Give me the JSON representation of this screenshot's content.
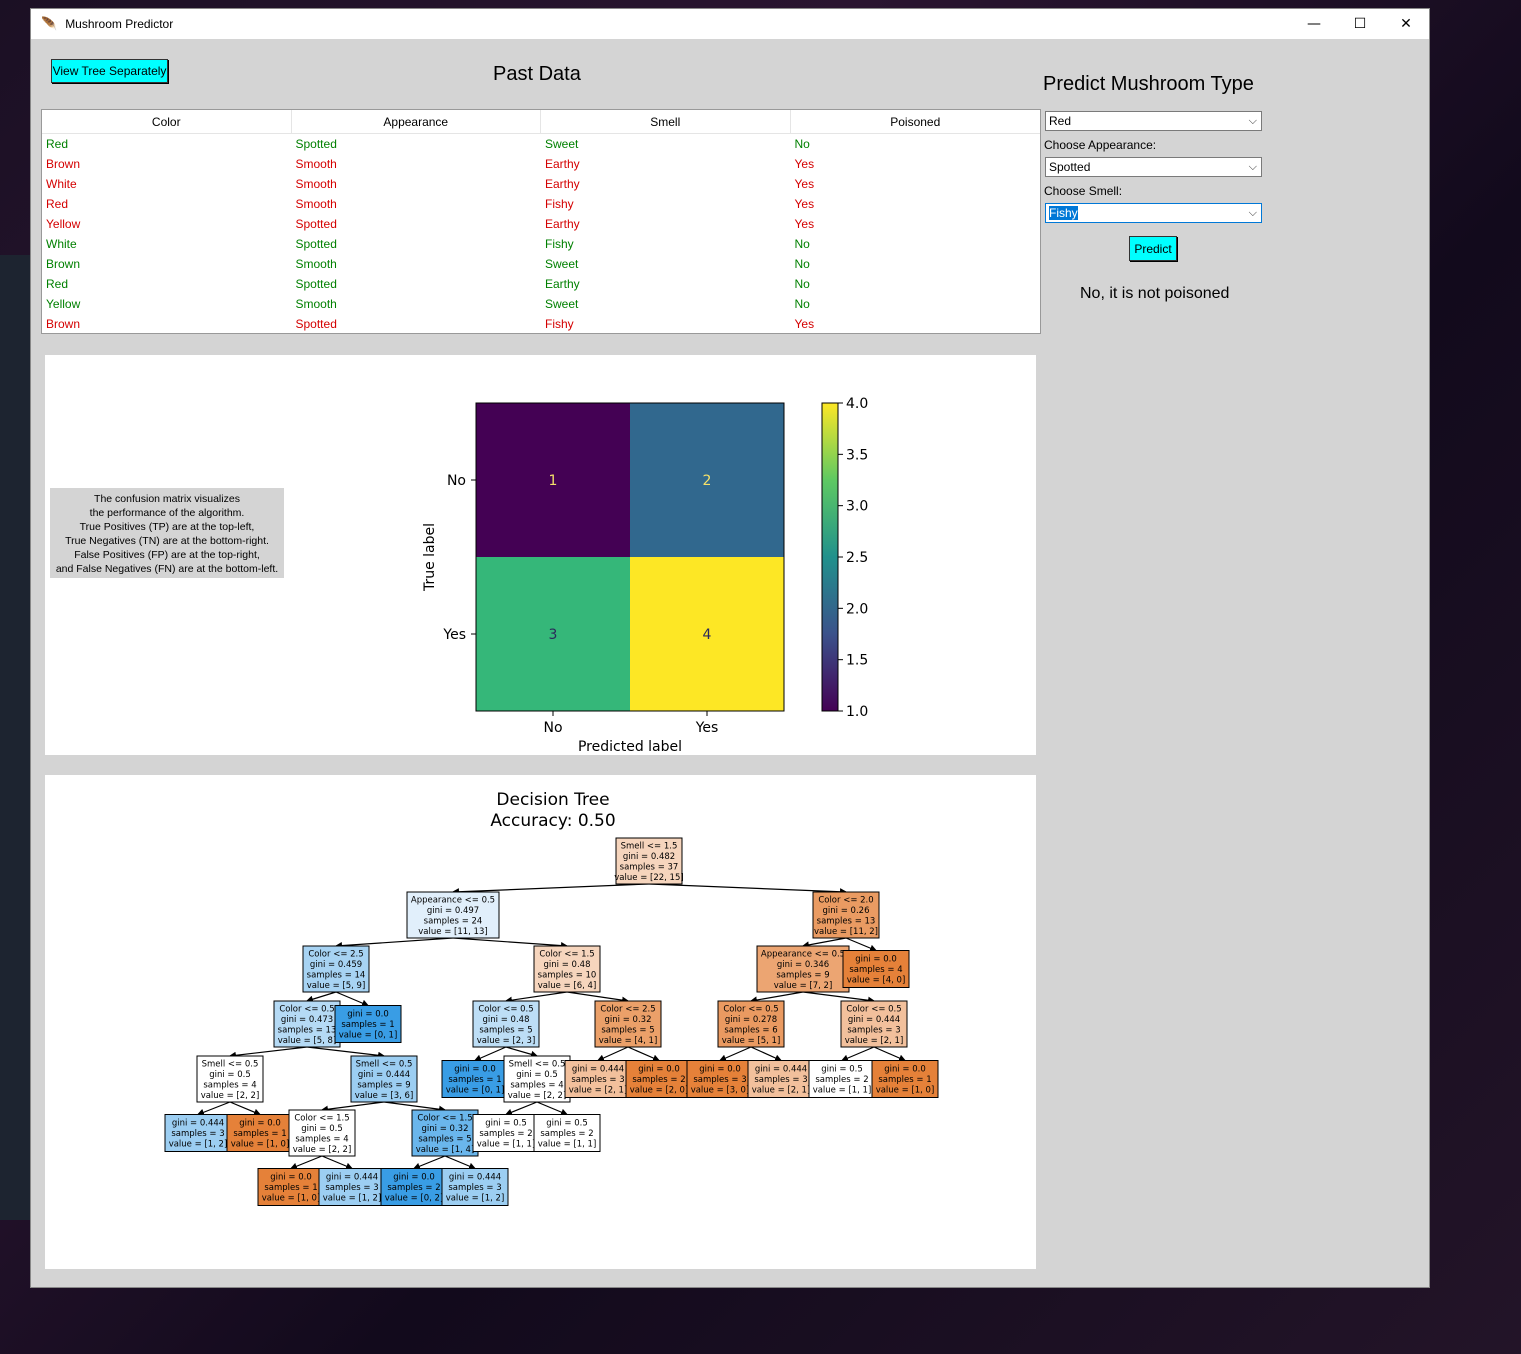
{
  "window": {
    "title": "Mushroom Predictor"
  },
  "toolbar": {
    "view_tree_label": "View Tree Separately"
  },
  "past_data": {
    "title": "Past Data",
    "columns": [
      "Color",
      "Appearance",
      "Smell",
      "Poisoned"
    ],
    "rows": [
      {
        "color": "Red",
        "appearance": "Spotted",
        "smell": "Sweet",
        "poisoned": "No",
        "status": "green"
      },
      {
        "color": "Brown",
        "appearance": "Smooth",
        "smell": "Earthy",
        "poisoned": "Yes",
        "status": "red"
      },
      {
        "color": "White",
        "appearance": "Smooth",
        "smell": "Earthy",
        "poisoned": "Yes",
        "status": "red"
      },
      {
        "color": "Red",
        "appearance": "Smooth",
        "smell": "Fishy",
        "poisoned": "Yes",
        "status": "red"
      },
      {
        "color": "Yellow",
        "appearance": "Spotted",
        "smell": "Earthy",
        "poisoned": "Yes",
        "status": "red"
      },
      {
        "color": "White",
        "appearance": "Spotted",
        "smell": "Fishy",
        "poisoned": "No",
        "status": "green"
      },
      {
        "color": "Brown",
        "appearance": "Smooth",
        "smell": "Sweet",
        "poisoned": "No",
        "status": "green"
      },
      {
        "color": "Red",
        "appearance": "Spotted",
        "smell": "Earthy",
        "poisoned": "No",
        "status": "green"
      },
      {
        "color": "Yellow",
        "appearance": "Smooth",
        "smell": "Sweet",
        "poisoned": "No",
        "status": "green"
      },
      {
        "color": "Brown",
        "appearance": "Spotted",
        "smell": "Fishy",
        "poisoned": "Yes",
        "status": "red"
      }
    ]
  },
  "predict": {
    "title": "Predict Mushroom Type",
    "color_value": "Red",
    "appearance_label": "Choose Appearance:",
    "appearance_value": "Spotted",
    "smell_label": "Choose Smell:",
    "smell_value": "Fishy",
    "button_label": "Predict",
    "result": "No, it is not poisoned"
  },
  "confusion_text": "The confusion matrix visualizes\nthe performance of the algorithm.\nTrue Positives (TP) are at the top-left,\nTrue Negatives (TN) are at the bottom-right.\nFalse Positives (FP) are at the top-right,\nand False Negatives (FN) are at the bottom-left.",
  "chart_data": [
    {
      "type": "heatmap",
      "rows": [
        "No",
        "Yes"
      ],
      "columns": [
        "No",
        "Yes"
      ],
      "values": [
        [
          1,
          2
        ],
        [
          3,
          4
        ]
      ],
      "xlabel": "Predicted label",
      "ylabel": "True label",
      "colorbar": {
        "min": 1.0,
        "max": 4.0,
        "ticks": [
          "1.0",
          "1.5",
          "2.0",
          "2.5",
          "3.0",
          "3.5",
          "4.0"
        ]
      },
      "colors": {
        "1": "#440154",
        "2": "#31688e",
        "3": "#35b779",
        "4": "#fde725"
      }
    }
  ],
  "decision_tree": {
    "title": "Decision Tree",
    "subtitle": "Accuracy: 0.50",
    "nodes": [
      {
        "id": "n0",
        "lines": [
          "Smell <= 1.5",
          "gini = 0.482",
          "samples = 37",
          "value = [22, 15]"
        ],
        "fill": "#f6d5bd"
      },
      {
        "id": "n1",
        "lines": [
          "Appearance <= 0.5",
          "gini = 0.497",
          "samples = 24",
          "value = [11, 13]"
        ],
        "fill": "#e1effb"
      },
      {
        "id": "n2",
        "lines": [
          "Color <= 2.0",
          "gini = 0.26",
          "samples = 13",
          "value = [11, 2]"
        ],
        "fill": "#ea9b62"
      },
      {
        "id": "n3",
        "lines": [
          "Color <= 2.5",
          "gini = 0.459",
          "samples = 14",
          "value = [5, 9]"
        ],
        "fill": "#a7d3f3"
      },
      {
        "id": "n4",
        "lines": [
          "Color <= 1.5",
          "gini = 0.48",
          "samples = 10",
          "value = [6, 4]"
        ],
        "fill": "#f6d5bd"
      },
      {
        "id": "n5",
        "lines": [
          "Appearance <= 0.5",
          "gini = 0.346",
          "samples = 9",
          "value = [7, 2]"
        ],
        "fill": "#eca572"
      },
      {
        "id": "n6",
        "lines": [
          "gini = 0.0",
          "samples = 4",
          "value = [4, 0]"
        ],
        "fill": "#e58139"
      },
      {
        "id": "n7",
        "lines": [
          "Color <= 0.5",
          "gini = 0.473",
          "samples = 13",
          "value = [5, 8]"
        ],
        "fill": "#b5daf5"
      },
      {
        "id": "n8",
        "lines": [
          "gini = 0.0",
          "samples = 1",
          "value = [0, 1]"
        ],
        "fill": "#399de5"
      },
      {
        "id": "n9",
        "lines": [
          "Color <= 0.5",
          "gini = 0.48",
          "samples = 5",
          "value = [2, 3]"
        ],
        "fill": "#bddef6"
      },
      {
        "id": "n10",
        "lines": [
          "Color <= 2.5",
          "gini = 0.32",
          "samples = 5",
          "value = [4, 1]"
        ],
        "fill": "#eba069"
      },
      {
        "id": "n11",
        "lines": [
          "Color <= 0.5",
          "gini = 0.278",
          "samples = 6",
          "value = [5, 1]"
        ],
        "fill": "#ea9a61"
      },
      {
        "id": "n12",
        "lines": [
          "Color <= 0.5",
          "gini = 0.444",
          "samples = 3",
          "value = [2, 1]"
        ],
        "fill": "#f2c09c"
      },
      {
        "id": "n13",
        "lines": [
          "Smell <= 0.5",
          "gini = 0.5",
          "samples = 4",
          "value = [2, 2]"
        ],
        "fill": "#ffffff"
      },
      {
        "id": "n14",
        "lines": [
          "Smell <= 0.5",
          "gini = 0.444",
          "samples = 9",
          "value = [3, 6]"
        ],
        "fill": "#9ccef2"
      },
      {
        "id": "n15",
        "lines": [
          "gini = 0.0",
          "samples = 1",
          "value = [0, 1]"
        ],
        "fill": "#399de5"
      },
      {
        "id": "n16",
        "lines": [
          "Smell <= 0.5",
          "gini = 0.5",
          "samples = 4",
          "value = [2, 2]"
        ],
        "fill": "#ffffff"
      },
      {
        "id": "n17",
        "lines": [
          "gini = 0.444",
          "samples = 3",
          "value = [2, 1]"
        ],
        "fill": "#f2c09c"
      },
      {
        "id": "n18",
        "lines": [
          "gini = 0.0",
          "samples = 2",
          "value = [2, 0]"
        ],
        "fill": "#e58139"
      },
      {
        "id": "n19",
        "lines": [
          "gini = 0.0",
          "samples = 3",
          "value = [3, 0]"
        ],
        "fill": "#e58139"
      },
      {
        "id": "n20",
        "lines": [
          "gini = 0.444",
          "samples = 3",
          "value = [2, 1]"
        ],
        "fill": "#f2c09c"
      },
      {
        "id": "n21",
        "lines": [
          "gini = 0.5",
          "samples = 2",
          "value = [1, 1]"
        ],
        "fill": "#ffffff"
      },
      {
        "id": "n22",
        "lines": [
          "gini = 0.0",
          "samples = 1",
          "value = [1, 0]"
        ],
        "fill": "#e58139"
      },
      {
        "id": "n23",
        "lines": [
          "gini = 0.444",
          "samples = 3",
          "value = [1, 2]"
        ],
        "fill": "#9ccef2"
      },
      {
        "id": "n24",
        "lines": [
          "gini = 0.0",
          "samples = 1",
          "value = [1, 0]"
        ],
        "fill": "#e58139"
      },
      {
        "id": "n25",
        "lines": [
          "Color <= 1.5",
          "gini = 0.5",
          "samples = 4",
          "value = [2, 2]"
        ],
        "fill": "#ffffff"
      },
      {
        "id": "n26",
        "lines": [
          "Color <= 1.5",
          "gini = 0.32",
          "samples = 5",
          "value = [1, 4]"
        ],
        "fill": "#6ab6ec"
      },
      {
        "id": "n27",
        "lines": [
          "gini = 0.5",
          "samples = 2",
          "value = [1, 1]"
        ],
        "fill": "#ffffff"
      },
      {
        "id": "n28",
        "lines": [
          "gini = 0.5",
          "samples = 2",
          "value = [1, 1]"
        ],
        "fill": "#ffffff"
      },
      {
        "id": "n29",
        "lines": [
          "gini = 0.0",
          "samples = 1",
          "value = [1, 0]"
        ],
        "fill": "#e58139"
      },
      {
        "id": "n30",
        "lines": [
          "gini = 0.444",
          "samples = 3",
          "value = [1, 2]"
        ],
        "fill": "#9ccef2"
      },
      {
        "id": "n31",
        "lines": [
          "gini = 0.0",
          "samples = 2",
          "value = [0, 2]"
        ],
        "fill": "#399de5"
      },
      {
        "id": "n32",
        "lines": [
          "gini = 0.444",
          "samples = 3",
          "value = [1, 2]"
        ],
        "fill": "#9ccef2"
      }
    ],
    "edges": [
      [
        "n0",
        "n1"
      ],
      [
        "n0",
        "n2"
      ],
      [
        "n1",
        "n3"
      ],
      [
        "n1",
        "n4"
      ],
      [
        "n2",
        "n5"
      ],
      [
        "n2",
        "n6"
      ],
      [
        "n3",
        "n7"
      ],
      [
        "n3",
        "n8"
      ],
      [
        "n4",
        "n9"
      ],
      [
        "n4",
        "n10"
      ],
      [
        "n5",
        "n11"
      ],
      [
        "n5",
        "n12"
      ],
      [
        "n7",
        "n13"
      ],
      [
        "n7",
        "n14"
      ],
      [
        "n9",
        "n15"
      ],
      [
        "n9",
        "n16"
      ],
      [
        "n10",
        "n17"
      ],
      [
        "n10",
        "n18"
      ],
      [
        "n11",
        "n19"
      ],
      [
        "n11",
        "n20"
      ],
      [
        "n12",
        "n21"
      ],
      [
        "n12",
        "n22"
      ],
      [
        "n13",
        "n23"
      ],
      [
        "n13",
        "n24"
      ],
      [
        "n14",
        "n25"
      ],
      [
        "n14",
        "n26"
      ],
      [
        "n16",
        "n27"
      ],
      [
        "n16",
        "n28"
      ],
      [
        "n25",
        "n29"
      ],
      [
        "n25",
        "n30"
      ],
      [
        "n26",
        "n31"
      ],
      [
        "n26",
        "n32"
      ]
    ]
  }
}
